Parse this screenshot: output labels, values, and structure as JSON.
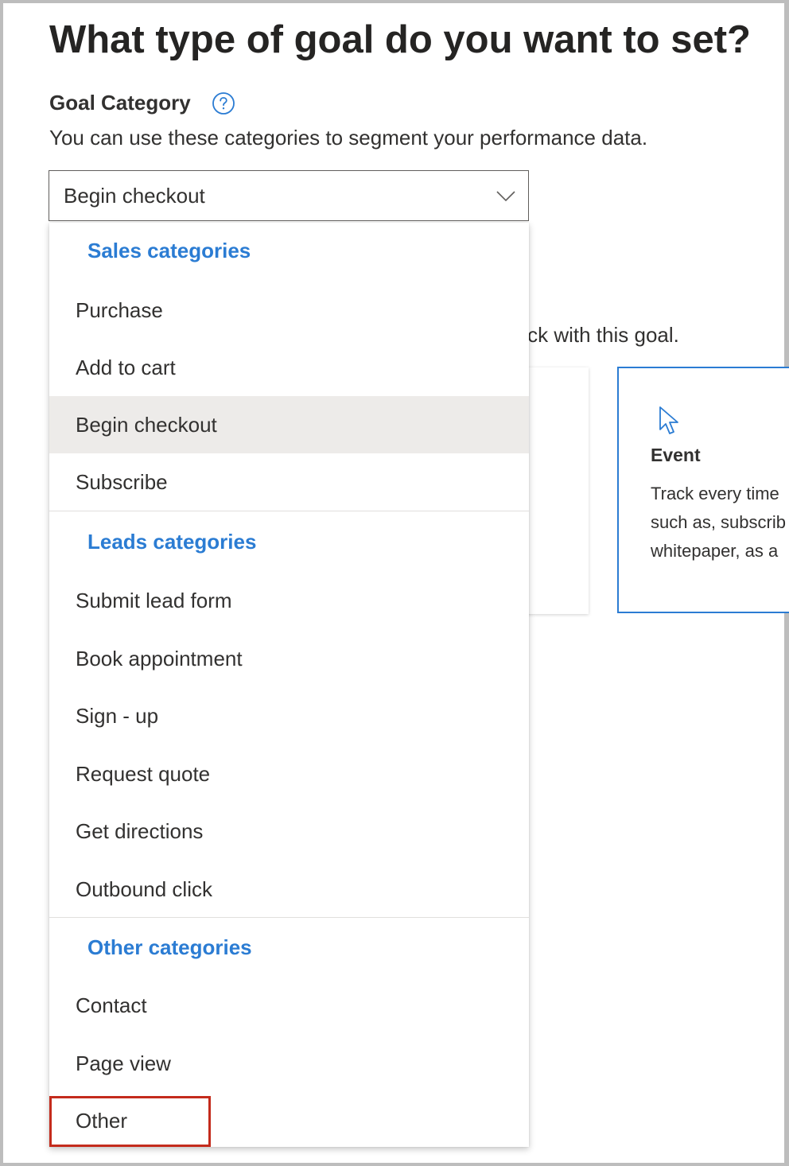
{
  "page": {
    "title": "What type of goal do you want to set?"
  },
  "goal_category": {
    "label": "Goal Category",
    "help_icon": "help-circle-icon",
    "description": "You can use these categories to segment your performance data.",
    "selected_value": "Begin checkout",
    "chevron_icon": "chevron-down-icon"
  },
  "background": {
    "prompt_fragment": "rack with this goal.",
    "event_card": {
      "icon": "cursor-pointer-icon",
      "title": "Event",
      "desc_lines": [
        "Track every time",
        "such as, subscrib",
        "whitepaper, as a"
      ]
    }
  },
  "dropdown": {
    "groups": [
      {
        "header": "Sales categories",
        "options": [
          "Purchase",
          "Add to cart",
          "Begin checkout",
          "Subscribe"
        ]
      },
      {
        "header": "Leads categories",
        "options": [
          "Submit lead form",
          "Book appointment",
          "Sign - up",
          "Request quote",
          "Get directions",
          "Outbound click"
        ]
      },
      {
        "header": "Other categories",
        "options": [
          "Contact",
          "Page view",
          "Other"
        ]
      }
    ],
    "selected_option": "Begin checkout",
    "highlighted_option": "Other"
  },
  "colors": {
    "accent": "#2b7cd3",
    "highlight_border": "#c42b1c",
    "selected_bg": "#edebe9",
    "text": "#323130"
  }
}
